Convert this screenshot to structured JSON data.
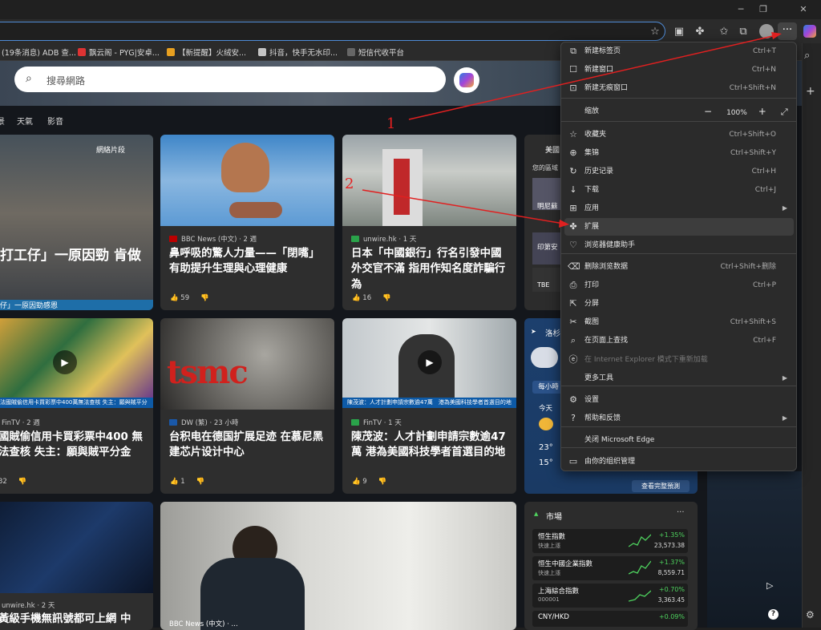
{
  "bookmarks": [
    {
      "label": "(19条消息) ADB 查...",
      "color": "#d44"
    },
    {
      "label": "飘云阁 - PYG|安卓...",
      "color": "#c33"
    },
    {
      "label": "【新提醒】火绒安...",
      "color": "#e8a020"
    },
    {
      "label": "抖音，快手无水印...",
      "color": "#c4c4c4"
    },
    {
      "label": "短信代收平台",
      "color": "#666"
    }
  ],
  "search": {
    "placeholder": "搜尋網路"
  },
  "nav_tabs": [
    "景",
    "天氣",
    "影音"
  ],
  "cards": [
    {
      "source": "",
      "title": "打工仔」一原因勁 肯做",
      "likes": "",
      "caption": "網絡片段",
      "strip": "仔」一原因勁感恩"
    },
    {
      "source": "BBC News (中文) · 2 週",
      "title": "鼻呼吸的驚人力量——「閉嘴」有助提升生理與心理健康",
      "likes": "59"
    },
    {
      "source": "unwire.hk · 1 天",
      "title": "日本「中國銀行」行名引發中國外交官不滿 指用作知名度詐騙行為",
      "likes": "16"
    },
    {
      "source": "FinTV · 2 週",
      "title": "國賊偷信用卡買彩票中400 無法查核 失主：願與賊平分金",
      "likes": "32",
      "strip": "法國賊偷信用卡買彩票中400萬無法查核 失主：願與賊平分"
    },
    {
      "source": "DW (繁) · 23 小時",
      "title": "台积电在德国扩展足迹 在慕尼黑建芯片设计中心",
      "likes": "1"
    },
    {
      "source": "FinTV · 1 天",
      "title": "陳茂波：人才計劃申請宗數逾47萬 港為美國科技學者首選目的地",
      "likes": "9",
      "strip": "陳茂波：人才計劃申請宗數逾47萬　港為美國科技學者首選目的地"
    },
    {
      "source": "unwire.hk · 2 天",
      "title": "黃級手機無訊號都可上網 中"
    },
    {
      "source": "BBC News (中文) · ..."
    }
  ],
  "weather": {
    "location": "洛杉",
    "hourly_label": "每小時",
    "today": "今天",
    "high": "23°",
    "low": "15°",
    "button": "查看完整預測"
  },
  "side_top": {
    "label": "美國",
    "sub": "您的區域",
    "items": [
      "明尼蘇",
      "印第安",
      "TBE"
    ]
  },
  "market": {
    "title": "市場",
    "rows": [
      {
        "name": "恒生指數",
        "sub": "快速上漲",
        "change": "+1.35%",
        "value": "23,573.38"
      },
      {
        "name": "恒生中國企業指數",
        "sub": "快速上漲",
        "change": "+1.37%",
        "value": "8,559.71"
      },
      {
        "name": "上海綜合指數",
        "sub": "000001",
        "change": "+0.70%",
        "value": "3,363.45"
      },
      {
        "name": "CNY/HKD",
        "sub": "",
        "change": "+0.09%",
        "value": ""
      }
    ]
  },
  "menu": {
    "items": [
      {
        "icon": "⧉",
        "label": "新建标签页",
        "shortcut": "Ctrl+T"
      },
      {
        "icon": "☐",
        "label": "新建窗口",
        "shortcut": "Ctrl+N"
      },
      {
        "icon": "⊡",
        "label": "新建无痕窗口",
        "shortcut": "Ctrl+Shift+N"
      },
      {
        "icon": "",
        "label": "缩放",
        "shortcut": ""
      },
      {
        "icon": "☆",
        "label": "收藏夹",
        "shortcut": "Ctrl+Shift+O"
      },
      {
        "icon": "⊕",
        "label": "集锦",
        "shortcut": "Ctrl+Shift+Y"
      },
      {
        "icon": "↻",
        "label": "历史记录",
        "shortcut": "Ctrl+H"
      },
      {
        "icon": "↓",
        "label": "下载",
        "shortcut": "Ctrl+J"
      },
      {
        "icon": "⊞",
        "label": "应用",
        "shortcut": "",
        "arrow": true
      },
      {
        "icon": "✤",
        "label": "扩展",
        "shortcut": ""
      },
      {
        "icon": "♡",
        "label": "浏览器健康助手",
        "shortcut": ""
      },
      {
        "icon": "⌫",
        "label": "删除浏览数据",
        "shortcut": "Ctrl+Shift+删除"
      },
      {
        "icon": "⎙",
        "label": "打印",
        "shortcut": "Ctrl+P"
      },
      {
        "icon": "⇱",
        "label": "分屏",
        "shortcut": ""
      },
      {
        "icon": "✂",
        "label": "截图",
        "shortcut": "Ctrl+Shift+S"
      },
      {
        "icon": "⌕",
        "label": "在页面上查找",
        "shortcut": "Ctrl+F"
      },
      {
        "icon": "ⓔ",
        "label": "在 Internet Explorer 模式下重新加载",
        "shortcut": "",
        "disabled": true
      },
      {
        "icon": "",
        "label": "更多工具",
        "shortcut": "",
        "arrow": true
      },
      {
        "icon": "⚙",
        "label": "设置",
        "shortcut": ""
      },
      {
        "icon": "?",
        "label": "帮助和反馈",
        "shortcut": "",
        "arrow": true
      },
      {
        "icon": "",
        "label": "关闭 Microsoft Edge",
        "shortcut": ""
      },
      {
        "icon": "▭",
        "label": "由你的组织管理",
        "shortcut": ""
      }
    ],
    "zoom": {
      "minus": "−",
      "value": "100%",
      "plus": "+"
    }
  },
  "annotations": {
    "one": "1",
    "two": "2"
  }
}
